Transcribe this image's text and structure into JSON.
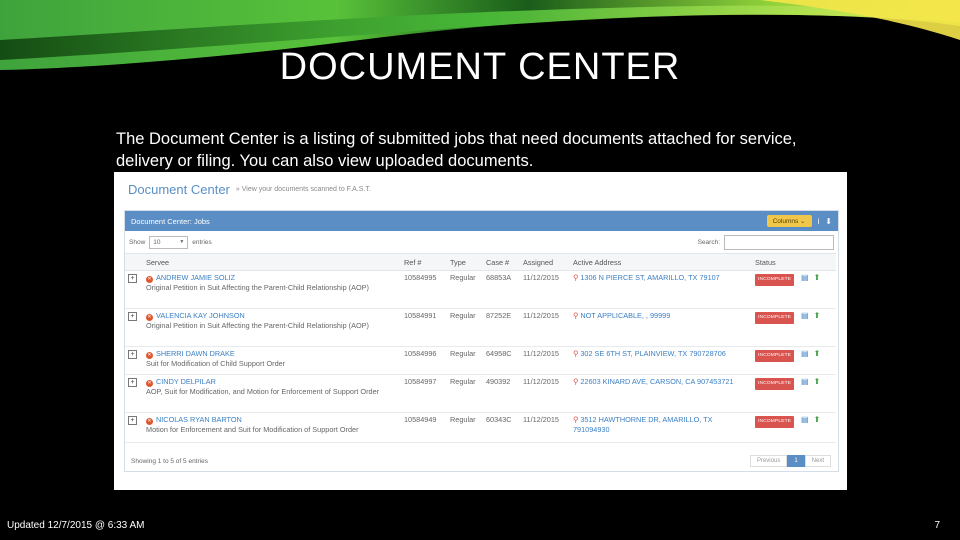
{
  "slide": {
    "title": "DOCUMENT CENTER",
    "intro": "The Document Center is a listing of submitted jobs that need documents attached for service, delivery or filing. You can also view uploaded documents.",
    "updated": "Updated 12/7/2015 @ 6:33 AM",
    "page_number": "7"
  },
  "colors": {
    "panel_blue": "#5b8ec5",
    "link_blue": "#3b7fc4",
    "badge_red": "#d9534f",
    "columns_yellow": "#f0c74a"
  },
  "app": {
    "title": "Document Center",
    "subtitle": "» View your documents scanned to F.A.S.T.",
    "panel_title": "Document Center: Jobs",
    "columns_label": "Columns",
    "show_label": "Show",
    "entries_value": "10",
    "entries_label": "entries",
    "search_label": "Search:",
    "headers": [
      "Servee",
      "Ref #",
      "Type",
      "Case #",
      "Assigned",
      "Active Address",
      "Status"
    ],
    "rows": [
      {
        "name": "ANDREW JAMIE SOLIZ",
        "desc": "Original Petition in Suit Affecting the Parent-Child Relationship (AOP)",
        "ref": "10584995",
        "type": "Regular",
        "case": "68853A",
        "assigned": "11/12/2015",
        "address": "1306 N PIERCE ST, AMARILLO, TX 79107",
        "status": "INCOMPLETE"
      },
      {
        "name": "VALENCIA KAY JOHNSON",
        "desc": "Original Petition in Suit Affecting the Parent-Child Relationship (AOP)",
        "ref": "10584991",
        "type": "Regular",
        "case": "87252E",
        "assigned": "11/12/2015",
        "address": "NOT APPLICABLE, , 99999",
        "status": "INCOMPLETE"
      },
      {
        "name": "SHERRI DAWN DRAKE",
        "desc": "Suit for Modification of Child Support Order",
        "ref": "10584996",
        "type": "Regular",
        "case": "64958C",
        "assigned": "11/12/2015",
        "address": "302 SE 6TH ST, PLAINVIEW, TX 790728706",
        "status": "INCOMPLETE"
      },
      {
        "name": "CINDY DELPILAR",
        "desc": "AOP, Suit for Modification, and Motion for Enforcement of Support Order",
        "ref": "10584997",
        "type": "Regular",
        "case": "490392",
        "assigned": "11/12/2015",
        "address": "22603 KINARD AVE, CARSON, CA 907453721",
        "status": "INCOMPLETE"
      },
      {
        "name": "NICOLAS RYAN BARTON",
        "desc": "Motion for Enforcement and Suit for Modification of Support Order",
        "ref": "10584949",
        "type": "Regular",
        "case": "60343C",
        "assigned": "11/12/2015",
        "address": "3512 HAWTHORNE DR, AMARILLO, TX 791094930",
        "status": "INCOMPLETE"
      }
    ],
    "footer_text": "Showing 1 to 5 of 5 entries",
    "pager": {
      "prev": "Previous",
      "current": "1",
      "next": "Next"
    }
  }
}
